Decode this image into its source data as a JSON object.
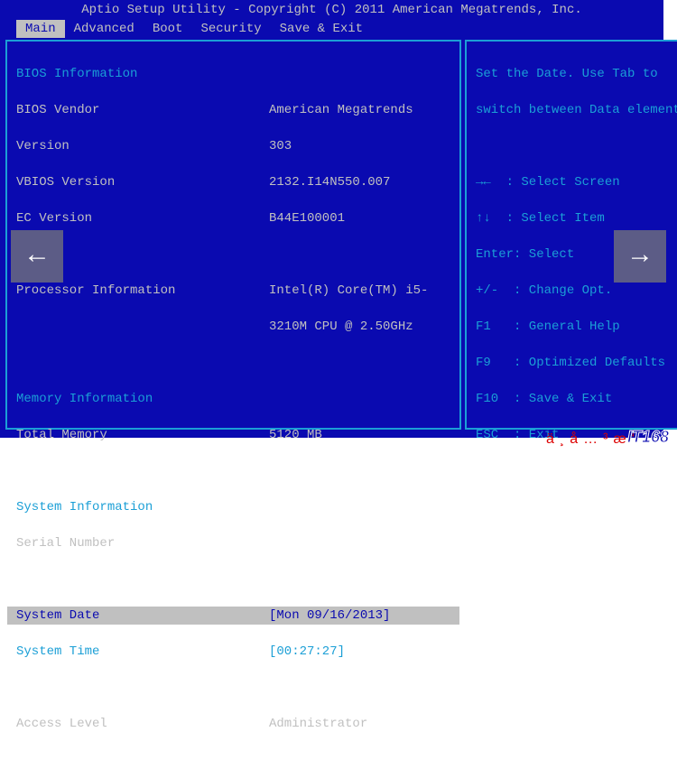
{
  "title": "Aptio Setup Utility - Copyright (C) 2011 American Megatrends, Inc.",
  "tabs": [
    "Main",
    "Advanced",
    "Boot",
    "Security",
    "Save & Exit"
  ],
  "selected_tab": 0,
  "sections": {
    "bios_info_header": "BIOS Information",
    "bios_vendor_label": "BIOS Vendor",
    "bios_vendor_value": "American Megatrends",
    "version_label": "Version",
    "version_value": "303",
    "vbios_label": "VBIOS Version",
    "vbios_value": "2132.I14N550.007",
    "ec_label": "EC Version",
    "ec_value": "B44E100001",
    "proc_info_label": "Processor Information",
    "proc_info_value1": "Intel(R) Core(TM) i5-",
    "proc_info_value2": "3210M CPU @ 2.50GHz",
    "mem_info_header": "Memory Information",
    "total_mem_label": "Total Memory",
    "total_mem_value": "5120 MB",
    "sys_info_header": "System Information",
    "serial_label": "Serial Number",
    "sys_date_label": "System Date",
    "sys_date_value": "[Mon 09/16/2013]",
    "sys_time_label": "System Time",
    "sys_time_value": "[00:27:27]",
    "access_label": "Access Level",
    "access_value": "Administrator"
  },
  "help": {
    "context1": "Set the Date. Use Tab to",
    "context2": "switch between Data elements.",
    "k_screen": "→←  : Select Screen",
    "k_item": "↑↓  : Select Item",
    "k_enter": "Enter: Select",
    "k_change": "+/-  : Change Opt.",
    "k_f1": "F1   : General Help",
    "k_f9": "F9   : Optimized Defaults",
    "k_f10": "F10  : Save & Exit",
    "k_esc": "ESC  : Exit"
  },
  "watermark": {
    "cn": "ä¸­å…³æ‘",
    "logo": "IT168"
  }
}
